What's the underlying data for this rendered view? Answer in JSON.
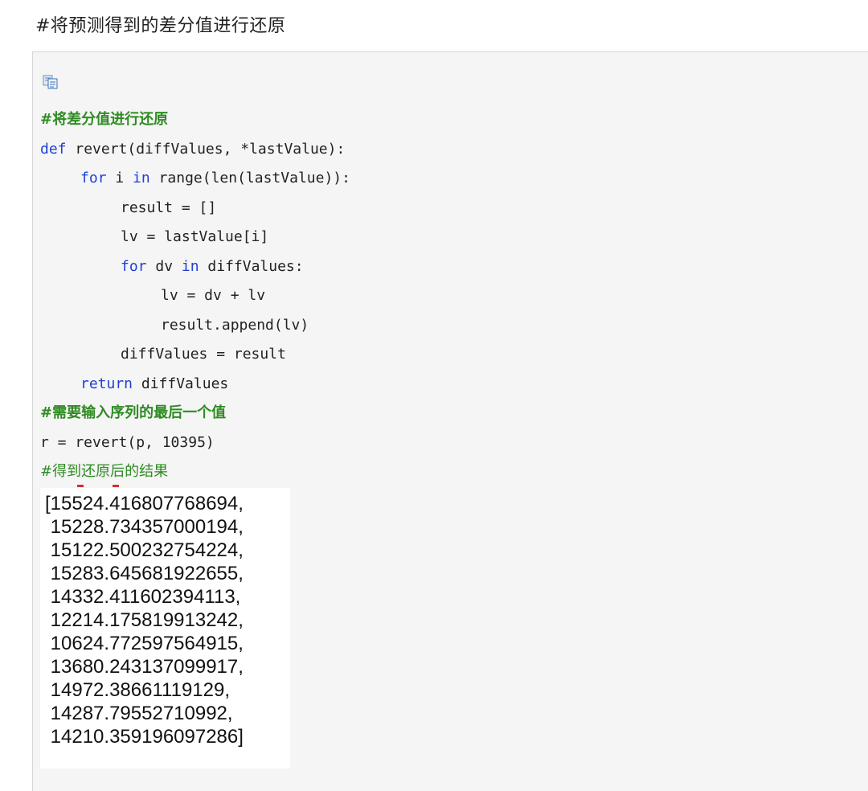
{
  "heading": "#将预测得到的差分值进行还原",
  "code": {
    "comment1": "#将差分值进行还原",
    "line_def_kw": "def",
    "line_def_rest": " revert(diffValues, *lastValue):",
    "line_for1_kw": "for",
    "line_for1_mid": " i ",
    "line_for1_in": "in",
    "line_for1_rest": " range(len(lastValue)):",
    "line_result": "result = []",
    "line_lv": "lv = lastValue[i]",
    "line_for2_kw": "for",
    "line_for2_mid": " dv ",
    "line_for2_in": "in",
    "line_for2_rest": " diffValues:",
    "line_lv_add": "lv = dv + lv",
    "line_append": "result.append(lv)",
    "line_diff": "diffValues = result",
    "line_return_kw": "return",
    "line_return_rest": " diffValues",
    "comment2": "#需要输入序列的最后一个值",
    "line_call": "r = revert(p, 10395)",
    "comment3": "#得到还原后的结果"
  },
  "output": [
    "[15524.416807768694,",
    " 15228.734357000194,",
    " 15122.500232754224,",
    " 15283.645681922655,",
    " 14332.411602394113,",
    " 12214.175819913242,",
    " 10624.772597564915,",
    " 13680.243137099917,",
    " 14972.38661119129,",
    " 14287.79552710992,",
    " 14210.359196097286]"
  ]
}
